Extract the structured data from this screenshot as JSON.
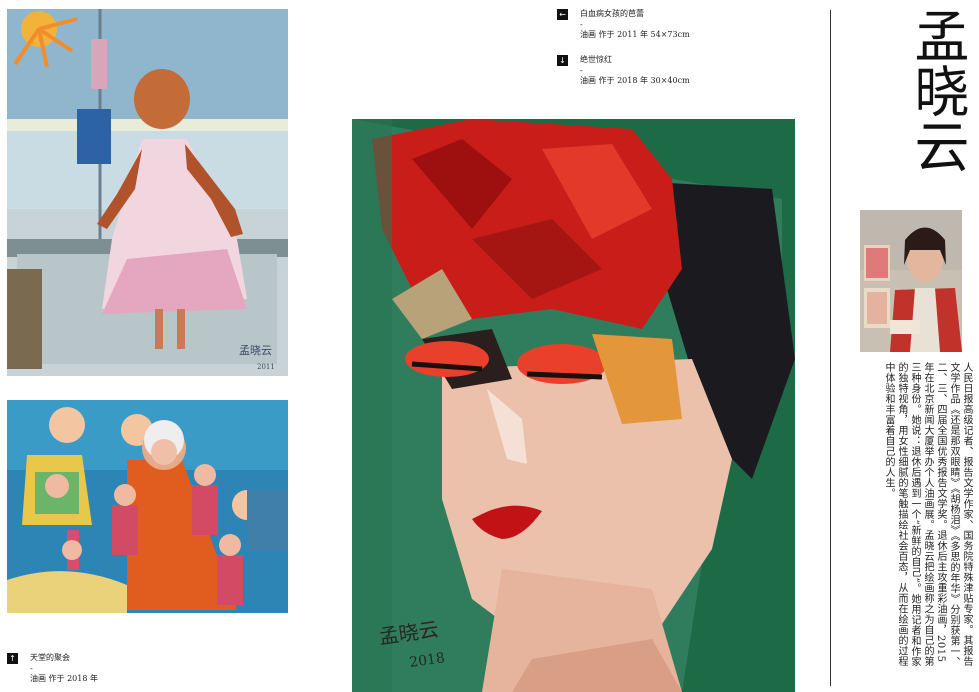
{
  "artist": {
    "name": "孟晓云",
    "bio": "人民日报高级记者、报告文学作家、国务院特殊津贴专家。其报告文学作品《还是那双眼睛》《胡杨泪》《多思的年华》分别获第一、二、三、四届全国优秀报告文学奖。退休后主攻重彩油画，2015年在北京新闻大厦举办个人油画展。孟晓云把绘画称之为自己的第三种身份。她说：退休后遇到一个“新鲜的自己”。她用记者和作家的独特视角，用女性细腻的笔触描绘社会百态，从而在绘画的过程中体验和丰富着自己的人生。"
  },
  "captions": {
    "top1": {
      "arrow": "←",
      "title": "白血病女孩的芭蕾",
      "dash": "-",
      "meta": "油画 作于 2011 年 54×73cm"
    },
    "top2": {
      "arrow": "↓",
      "title": "绝世惊红",
      "dash": "-",
      "meta": "油画 作于 2018 年 30×40cm"
    },
    "bottom": {
      "arrow": "↑",
      "title": "天堂的聚会",
      "dash": "-",
      "meta": "油画 作于 2018 年"
    }
  },
  "paintings": {
    "ballet_signature": "孟晓云",
    "ballet_date": "2011",
    "portrait_signature": "孟晓云",
    "portrait_date": "2018"
  },
  "colors": {
    "page": "#ffffff",
    "text": "#222222",
    "rule": "#333333"
  }
}
